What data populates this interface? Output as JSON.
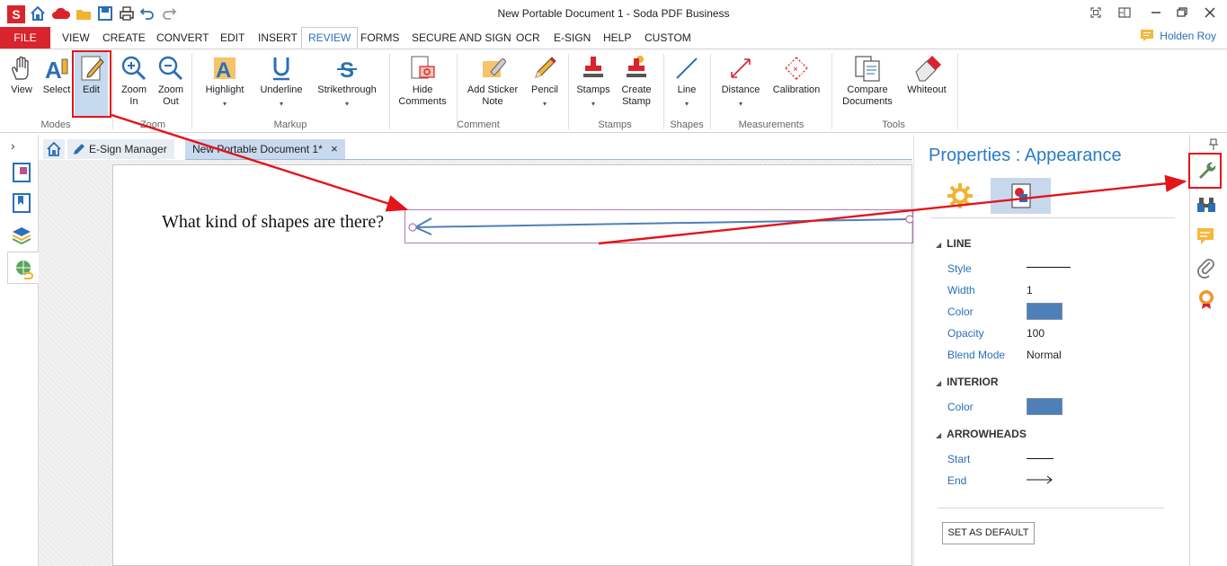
{
  "window": {
    "title": "New Portable Document 1   -   Soda PDF Business",
    "user_name": "Holden Roy"
  },
  "menu": {
    "file": "FILE",
    "tabs": [
      "VIEW",
      "CREATE",
      "CONVERT",
      "EDIT",
      "INSERT",
      "REVIEW",
      "FORMS",
      "SECURE AND SIGN",
      "OCR",
      "E-SIGN",
      "HELP",
      "CUSTOM"
    ],
    "active_tab": "REVIEW"
  },
  "ribbon": {
    "buttons": {
      "view": "View",
      "select": "Select",
      "edit": "Edit",
      "zoom_in": [
        "Zoom",
        "In"
      ],
      "zoom_out": [
        "Zoom",
        "Out"
      ],
      "highlight": "Highlight",
      "underline": "Underline",
      "strikethrough": "Strikethrough",
      "hide_comments": [
        "Hide",
        "Comments"
      ],
      "add_sticker_note": [
        "Add Sticker",
        "Note"
      ],
      "pencil": "Pencil",
      "stamps": "Stamps",
      "create_stamp": [
        "Create",
        "Stamp"
      ],
      "line": "Line",
      "distance": "Distance",
      "calibration": "Calibration",
      "compare_documents": [
        "Compare",
        "Documents"
      ],
      "whiteout": "Whiteout"
    },
    "groups": {
      "modes": "Modes",
      "zoom": "Zoom",
      "markup": "Markup",
      "comment": "Comment",
      "stamps": "Stamps",
      "shapes": "Shapes",
      "measurements": "Measurements",
      "tools": "Tools"
    }
  },
  "doc_tabs": {
    "esign_manager": "E-Sign Manager",
    "current_doc": "New Portable Document 1*",
    "close_glyph": "×"
  },
  "document": {
    "text": "What kind of shapes are there?"
  },
  "properties": {
    "title": "Properties : Appearance",
    "line_section": "LINE",
    "line": {
      "style_label": "Style",
      "width_label": "Width",
      "width_value": "1",
      "color_label": "Color",
      "color_value": "#4e7fb8",
      "opacity_label": "Opacity",
      "opacity_value": "100",
      "blend_label": "Blend Mode",
      "blend_value": "Normal"
    },
    "interior_section": "INTERIOR",
    "interior": {
      "color_label": "Color",
      "color_value": "#4e7fb8"
    },
    "arrowheads_section": "ARROWHEADS",
    "arrowheads": {
      "start_label": "Start",
      "end_label": "End"
    },
    "set_default": "SET AS DEFAULT"
  },
  "colors": {
    "accent": "#2b7bc4",
    "file_red": "#d9232d",
    "annotation_red": "#e3141a",
    "selection_blue": "#c5d9ef"
  }
}
